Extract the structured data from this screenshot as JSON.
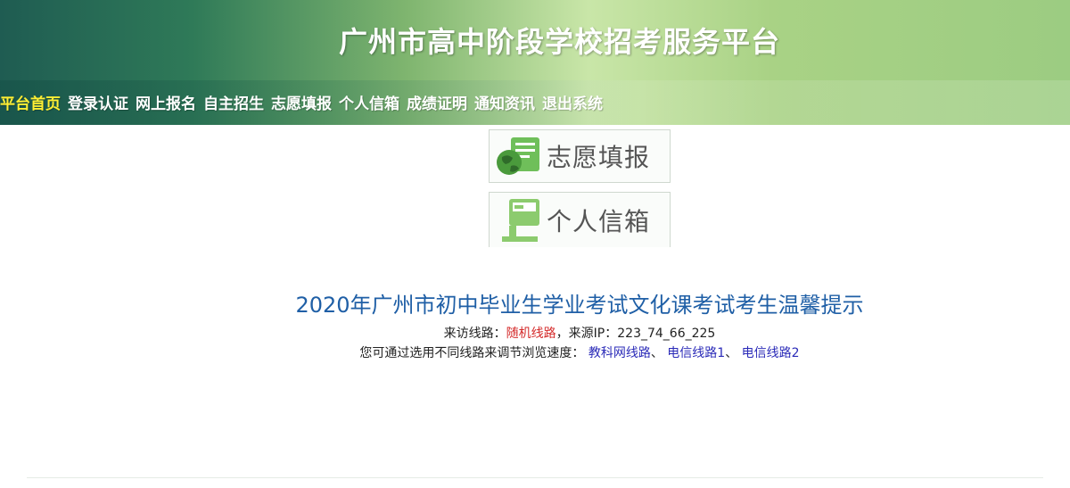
{
  "header": {
    "title": "广州市高中阶段学校招考服务平台"
  },
  "nav": {
    "items": [
      "平台首页",
      "登录认证",
      "网上报名",
      "自主招生",
      "志愿填报",
      "个人信箱",
      "成绩证明",
      "通知资讯",
      "退出系统"
    ],
    "active_color": "#ffef33"
  },
  "shortcuts": [
    {
      "label": "志愿填报",
      "icon": "globe-form-icon"
    },
    {
      "label": "个人信箱",
      "icon": "mailbox-icon"
    }
  ],
  "notice": {
    "title": "2020年广州市初中毕业生学业考试文化课考试考生温馨提示",
    "route_label": "来访线路：",
    "route_value": "随机线路",
    "ip_label": "，来源IP：",
    "ip_value": "223_74_66_225",
    "choose_text": "您可通过选用不同线路来调节浏览速度：",
    "routes": [
      "教科网线路",
      "电信线路1",
      "电信线路2"
    ],
    "separator": "、"
  },
  "colors": {
    "title_blue": "#1f5fa6",
    "route_red": "#d42a2a",
    "link_blue": "#2b2bb8"
  }
}
